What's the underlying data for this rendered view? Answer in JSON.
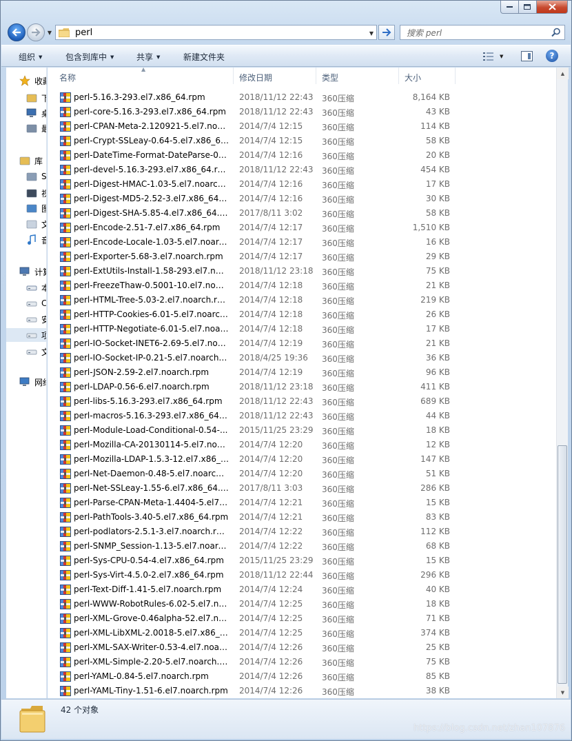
{
  "address": {
    "path": "perl"
  },
  "search": {
    "placeholder": "搜索 perl"
  },
  "toolbar": {
    "organize": "组织",
    "include_in_library": "包含到库中",
    "share": "共享",
    "new_folder": "新建文件夹"
  },
  "nav_pane": {
    "items": [
      {
        "label": "收藏",
        "icon": "star-icon"
      },
      {
        "label": "下",
        "icon": "downloads-folder-icon"
      },
      {
        "label": "桌",
        "icon": "desktop-icon"
      },
      {
        "label": "最",
        "icon": "recent-places-icon"
      },
      {
        "label": "库",
        "icon": "libraries-icon"
      },
      {
        "label": "S",
        "icon": "library-icon"
      },
      {
        "label": "视",
        "icon": "videos-icon"
      },
      {
        "label": "图",
        "icon": "pictures-icon"
      },
      {
        "label": "文",
        "icon": "documents-icon"
      },
      {
        "label": "音",
        "icon": "music-icon"
      },
      {
        "label": "计算",
        "icon": "computer-icon"
      },
      {
        "label": "本",
        "icon": "windows-drive-icon"
      },
      {
        "label": "C",
        "icon": "drive-icon"
      },
      {
        "label": "安",
        "icon": "drive-icon"
      },
      {
        "label": "项",
        "icon": "drive-icon"
      },
      {
        "label": "文",
        "icon": "drive-icon"
      },
      {
        "label": "网络",
        "icon": "network-icon"
      }
    ]
  },
  "columns": {
    "name": "名称",
    "date": "修改日期",
    "type": "类型",
    "size": "大小"
  },
  "files": [
    {
      "name": "perl-5.16.3-293.el7.x86_64.rpm",
      "date": "2018/11/12 22:43",
      "type": "360压缩",
      "size": "8,164 KB"
    },
    {
      "name": "perl-core-5.16.3-293.el7.x86_64.rpm",
      "date": "2018/11/12 22:43",
      "type": "360压缩",
      "size": "43 KB"
    },
    {
      "name": "perl-CPAN-Meta-2.120921-5.el7.noar...",
      "date": "2014/7/4 12:15",
      "type": "360压缩",
      "size": "114 KB"
    },
    {
      "name": "perl-Crypt-SSLeay-0.64-5.el7.x86_64.r...",
      "date": "2014/7/4 12:15",
      "type": "360压缩",
      "size": "58 KB"
    },
    {
      "name": "perl-DateTime-Format-DateParse-0.0...",
      "date": "2014/7/4 12:16",
      "type": "360压缩",
      "size": "20 KB"
    },
    {
      "name": "perl-devel-5.16.3-293.el7.x86_64.rpm",
      "date": "2018/11/12 22:43",
      "type": "360压缩",
      "size": "454 KB"
    },
    {
      "name": "perl-Digest-HMAC-1.03-5.el7.noarch....",
      "date": "2014/7/4 12:16",
      "type": "360压缩",
      "size": "17 KB"
    },
    {
      "name": "perl-Digest-MD5-2.52-3.el7.x86_64.rp...",
      "date": "2014/7/4 12:16",
      "type": "360压缩",
      "size": "30 KB"
    },
    {
      "name": "perl-Digest-SHA-5.85-4.el7.x86_64.rpm",
      "date": "2017/8/11 3:02",
      "type": "360压缩",
      "size": "58 KB"
    },
    {
      "name": "perl-Encode-2.51-7.el7.x86_64.rpm",
      "date": "2014/7/4 12:17",
      "type": "360压缩",
      "size": "1,510 KB"
    },
    {
      "name": "perl-Encode-Locale-1.03-5.el7.noarch...",
      "date": "2014/7/4 12:17",
      "type": "360压缩",
      "size": "16 KB"
    },
    {
      "name": "perl-Exporter-5.68-3.el7.noarch.rpm",
      "date": "2014/7/4 12:17",
      "type": "360压缩",
      "size": "29 KB"
    },
    {
      "name": "perl-ExtUtils-Install-1.58-293.el7.noar...",
      "date": "2018/11/12 23:18",
      "type": "360压缩",
      "size": "75 KB"
    },
    {
      "name": "perl-FreezeThaw-0.5001-10.el7.noarc...",
      "date": "2014/7/4 12:18",
      "type": "360压缩",
      "size": "21 KB"
    },
    {
      "name": "perl-HTML-Tree-5.03-2.el7.noarch.rpm",
      "date": "2014/7/4 12:18",
      "type": "360压缩",
      "size": "219 KB"
    },
    {
      "name": "perl-HTTP-Cookies-6.01-5.el7.noarch....",
      "date": "2014/7/4 12:18",
      "type": "360压缩",
      "size": "26 KB"
    },
    {
      "name": "perl-HTTP-Negotiate-6.01-5.el7.noar...",
      "date": "2014/7/4 12:18",
      "type": "360压缩",
      "size": "17 KB"
    },
    {
      "name": "perl-IO-Socket-INET6-2.69-5.el7.noar...",
      "date": "2014/7/4 12:19",
      "type": "360压缩",
      "size": "21 KB"
    },
    {
      "name": "perl-IO-Socket-IP-0.21-5.el7.noarch.r...",
      "date": "2018/4/25 19:36",
      "type": "360压缩",
      "size": "36 KB"
    },
    {
      "name": "perl-JSON-2.59-2.el7.noarch.rpm",
      "date": "2014/7/4 12:19",
      "type": "360压缩",
      "size": "96 KB"
    },
    {
      "name": "perl-LDAP-0.56-6.el7.noarch.rpm",
      "date": "2018/11/12 23:18",
      "type": "360压缩",
      "size": "411 KB"
    },
    {
      "name": "perl-libs-5.16.3-293.el7.x86_64.rpm",
      "date": "2018/11/12 22:43",
      "type": "360压缩",
      "size": "689 KB"
    },
    {
      "name": "perl-macros-5.16.3-293.el7.x86_64.rpm",
      "date": "2018/11/12 22:43",
      "type": "360压缩",
      "size": "44 KB"
    },
    {
      "name": "perl-Module-Load-Conditional-0.54-...",
      "date": "2015/11/25 23:29",
      "type": "360压缩",
      "size": "18 KB"
    },
    {
      "name": "perl-Mozilla-CA-20130114-5.el7.noar...",
      "date": "2014/7/4 12:20",
      "type": "360压缩",
      "size": "12 KB"
    },
    {
      "name": "perl-Mozilla-LDAP-1.5.3-12.el7.x86_6...",
      "date": "2014/7/4 12:20",
      "type": "360压缩",
      "size": "147 KB"
    },
    {
      "name": "perl-Net-Daemon-0.48-5.el7.noarch.r...",
      "date": "2014/7/4 12:20",
      "type": "360压缩",
      "size": "51 KB"
    },
    {
      "name": "perl-Net-SSLeay-1.55-6.el7.x86_64.rpm",
      "date": "2017/8/11 3:03",
      "type": "360压缩",
      "size": "286 KB"
    },
    {
      "name": "perl-Parse-CPAN-Meta-1.4404-5.el7....",
      "date": "2014/7/4 12:21",
      "type": "360压缩",
      "size": "15 KB"
    },
    {
      "name": "perl-PathTools-3.40-5.el7.x86_64.rpm",
      "date": "2014/7/4 12:21",
      "type": "360压缩",
      "size": "83 KB"
    },
    {
      "name": "perl-podlators-2.5.1-3.el7.noarch.rpm",
      "date": "2014/7/4 12:22",
      "type": "360压缩",
      "size": "112 KB"
    },
    {
      "name": "perl-SNMP_Session-1.13-5.el7.noarch...",
      "date": "2014/7/4 12:22",
      "type": "360压缩",
      "size": "68 KB"
    },
    {
      "name": "perl-Sys-CPU-0.54-4.el7.x86_64.rpm",
      "date": "2015/11/25 23:29",
      "type": "360压缩",
      "size": "15 KB"
    },
    {
      "name": "perl-Sys-Virt-4.5.0-2.el7.x86_64.rpm",
      "date": "2018/11/12 22:44",
      "type": "360压缩",
      "size": "296 KB"
    },
    {
      "name": "perl-Text-Diff-1.41-5.el7.noarch.rpm",
      "date": "2014/7/4 12:24",
      "type": "360压缩",
      "size": "40 KB"
    },
    {
      "name": "perl-WWW-RobotRules-6.02-5.el7.no...",
      "date": "2014/7/4 12:25",
      "type": "360压缩",
      "size": "18 KB"
    },
    {
      "name": "perl-XML-Grove-0.46alpha-52.el7.no...",
      "date": "2014/7/4 12:25",
      "type": "360压缩",
      "size": "71 KB"
    },
    {
      "name": "perl-XML-LibXML-2.0018-5.el7.x86_6...",
      "date": "2014/7/4 12:25",
      "type": "360压缩",
      "size": "374 KB"
    },
    {
      "name": "perl-XML-SAX-Writer-0.53-4.el7.noar...",
      "date": "2014/7/4 12:26",
      "type": "360压缩",
      "size": "25 KB"
    },
    {
      "name": "perl-XML-Simple-2.20-5.el7.noarch.r...",
      "date": "2014/7/4 12:26",
      "type": "360压缩",
      "size": "75 KB"
    },
    {
      "name": "perl-YAML-0.84-5.el7.noarch.rpm",
      "date": "2014/7/4 12:26",
      "type": "360压缩",
      "size": "85 KB"
    },
    {
      "name": "perl-YAML-Tiny-1.51-6.el7.noarch.rpm",
      "date": "2014/7/4 12:26",
      "type": "360压缩",
      "size": "38 KB"
    }
  ],
  "status": {
    "count_text": "42 个对象",
    "watermark": "https://blog.csdn.net/zhan107876"
  }
}
